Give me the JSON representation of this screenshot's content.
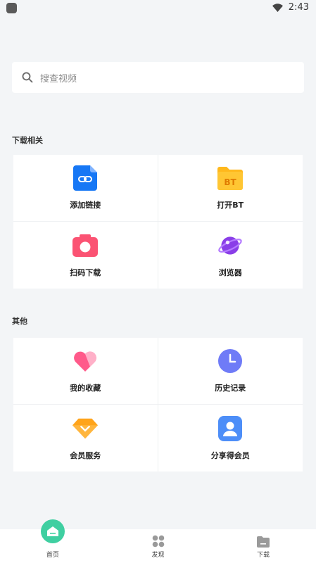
{
  "status_bar": {
    "time": "2:43"
  },
  "search": {
    "placeholder": "搜查视频"
  },
  "sections": [
    {
      "title": "下载相关",
      "items": [
        {
          "label": "添加链接",
          "icon": "link-icon"
        },
        {
          "label": "打开BT",
          "icon": "bt-folder-icon",
          "icon_text": "BT"
        },
        {
          "label": "扫码下载",
          "icon": "camera-scan-icon"
        },
        {
          "label": "浏览器",
          "icon": "planet-browser-icon"
        }
      ]
    },
    {
      "title": "其他",
      "items": [
        {
          "label": "我的收藏",
          "icon": "heart-icon"
        },
        {
          "label": "历史记录",
          "icon": "clock-icon"
        },
        {
          "label": "会员服务",
          "icon": "diamond-icon"
        },
        {
          "label": "分享得会员",
          "icon": "user-share-icon"
        }
      ]
    }
  ],
  "bottom_nav": [
    {
      "label": "首页",
      "icon": "home-icon",
      "active": true
    },
    {
      "label": "发现",
      "icon": "discover-icon",
      "active": false
    },
    {
      "label": "下载",
      "icon": "download-folder-icon",
      "active": false
    }
  ],
  "colors": {
    "background": "#f3f5f7",
    "accent_green": "#3fcfa1",
    "link_blue": "#1677f5",
    "bt_yellow": "#ffb81c",
    "camera_red": "#fb5373",
    "browser_purple": "#8a3ee8",
    "heart_pink": "#ff5a8a",
    "clock_purple": "#6f7bf7",
    "diamond_orange": "#ffa41b",
    "share_blue": "#4d8ef8"
  }
}
